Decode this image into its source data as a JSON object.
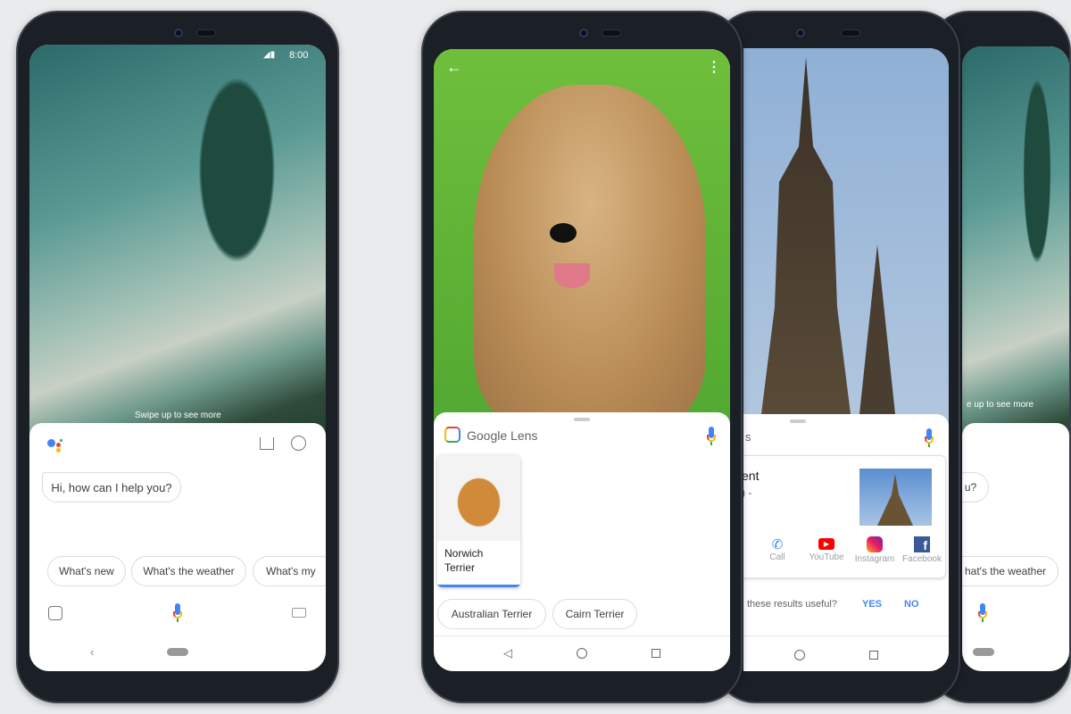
{
  "phone1": {
    "status_time": "8:00",
    "swipe_hint": "Swipe up to see more",
    "greeting": "Hi, how can I help you?",
    "suggestions": [
      "What's new",
      "What's the weather",
      "What's my"
    ]
  },
  "phone2": {
    "app_title": "Google Lens",
    "result_name": "Norwich Terrier",
    "chips": [
      "Australian Terrier",
      "Cairn Terrier"
    ]
  },
  "phone3": {
    "title_fragment": "s",
    "card_title_fragment": "ent",
    "card_sub_fragment": ") -",
    "actions": [
      {
        "label": "Call",
        "icon": "phone-icon"
      },
      {
        "label": "YouTube",
        "icon": "youtube-icon"
      },
      {
        "label": "Instagram",
        "icon": "instagram-icon"
      },
      {
        "label": "Facebook",
        "icon": "facebook-icon"
      }
    ],
    "feedback_question": "these results useful?",
    "yes": "YES",
    "no": "NO"
  },
  "phone4": {
    "swipe_hint": "e up to see more",
    "greeting_fragment": "u?",
    "suggestion_fragment": "hat's the weather"
  },
  "colors": {
    "accent": "#4285f4",
    "background": "#e9ebed"
  }
}
